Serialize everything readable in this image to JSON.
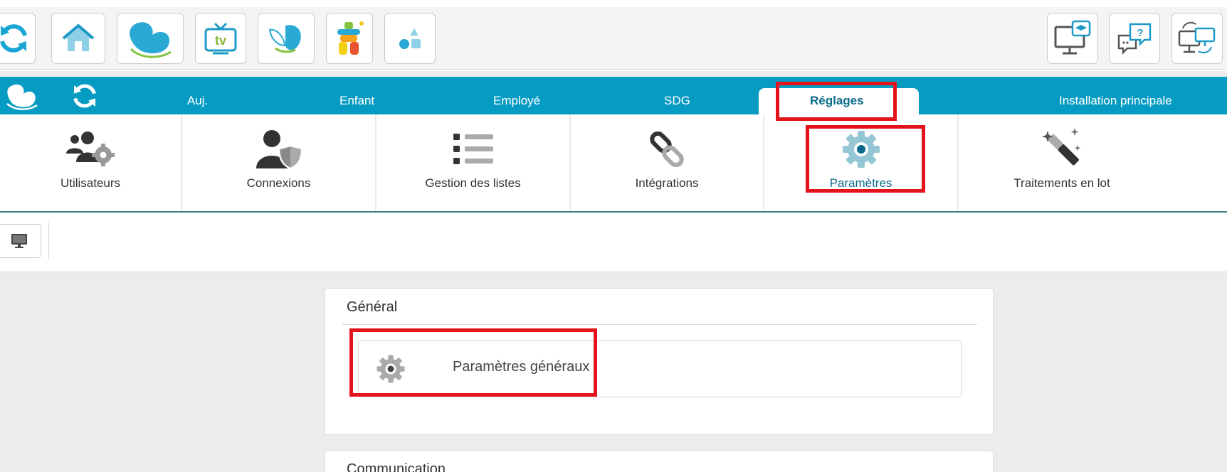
{
  "toolbar": {
    "left_buttons": [
      {
        "icon": "refresh-icon"
      },
      {
        "icon": "home-icon"
      },
      {
        "icon": "leaf-logo-icon"
      },
      {
        "icon": "tv-icon",
        "text": "tv"
      },
      {
        "icon": "butterfly-icon"
      },
      {
        "icon": "inukshuk-icon"
      },
      {
        "icon": "shapes-icon"
      }
    ],
    "right_buttons": [
      {
        "icon": "training-monitor-icon"
      },
      {
        "icon": "help-chat-icon"
      },
      {
        "icon": "remote-desktop-icon"
      }
    ]
  },
  "nav": {
    "tabs": [
      {
        "label": "Auj."
      },
      {
        "label": "Enfant"
      },
      {
        "label": "Employé"
      },
      {
        "label": "SDG"
      },
      {
        "label": "Réglages",
        "active": true
      },
      {
        "label": "Installation principale"
      }
    ]
  },
  "submenu": {
    "items": [
      {
        "label": "Utilisateurs",
        "icon": "users-gear-icon"
      },
      {
        "label": "Connexions",
        "icon": "user-shield-icon"
      },
      {
        "label": "Gestion des listes",
        "icon": "list-icon"
      },
      {
        "label": "Intégrations",
        "icon": "link-icon"
      },
      {
        "label": "Paramètres",
        "icon": "gear-icon",
        "active": true
      },
      {
        "label": "Traitements en lot",
        "icon": "magic-wand-icon"
      }
    ]
  },
  "main": {
    "sections": [
      {
        "title": "Général",
        "items": [
          {
            "label": "Paramètres généraux",
            "icon": "gear-icon"
          }
        ]
      },
      {
        "title": "Communication"
      }
    ]
  },
  "colors": {
    "nav_bg": "#069bc3",
    "active_text": "#0b6a8a",
    "highlight": "#e3131c"
  }
}
